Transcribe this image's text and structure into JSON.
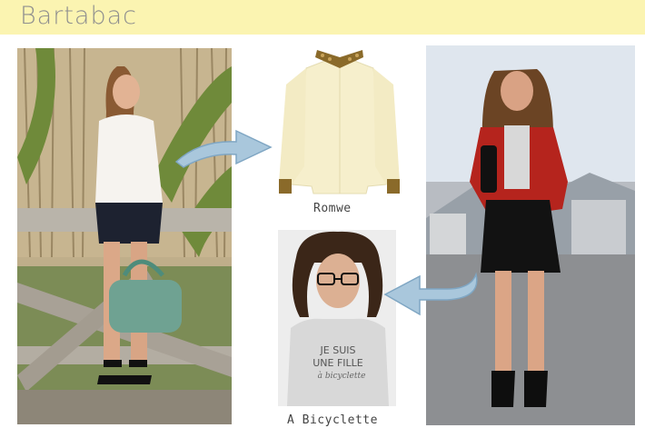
{
  "header": {
    "title": "Bartabac"
  },
  "products": [
    {
      "caption": "Romwe",
      "item": "cream blouse with sequin collar"
    },
    {
      "caption": "A Bicyclette",
      "item": "grey slogan t-shirt"
    }
  ],
  "tshirt_print": {
    "line1": "JE SUIS",
    "line2": "UNE FILLE",
    "line3": "à bicyclette"
  },
  "colors": {
    "header_bg": "#fbf4b1",
    "title": "#8f8f8f",
    "arrow": "#a9c7dc",
    "arrow_stroke": "#7fa6c3"
  }
}
